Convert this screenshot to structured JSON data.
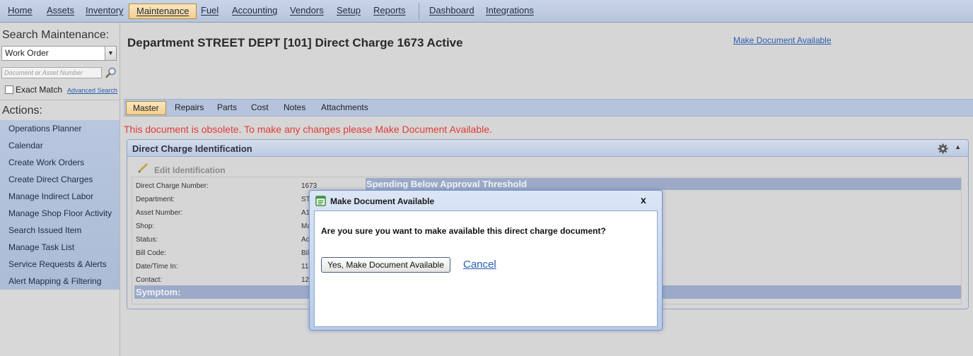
{
  "topmenu": {
    "items": [
      "Home",
      "Assets",
      "Inventory",
      "Maintenance",
      "Fuel",
      "Accounting",
      "Vendors",
      "Setup",
      "Reports",
      "Dashboard",
      "Integrations"
    ]
  },
  "left": {
    "search_title": "Search Maintenance:",
    "search_type": "Work Order",
    "doc_placeholder": "Document or Asset Number",
    "exact_match": "Exact Match",
    "advanced_search": "Advanced Search",
    "actions_title": "Actions:",
    "actions": [
      "Operations Planner",
      "Calendar",
      "Create Work Orders",
      "Create Direct Charges",
      "Manage Indirect Labor",
      "Manage Shop Floor Activity",
      "Search Issued Item",
      "Manage Task List",
      "Service Requests & Alerts",
      "Alert Mapping & Filtering"
    ]
  },
  "main": {
    "title": "Department STREET DEPT [101]  Direct Charge 1673  Active",
    "make_available_link": "Make Document Available",
    "tabs": [
      "Master",
      "Repairs",
      "Parts",
      "Cost",
      "Notes",
      "Attachments"
    ],
    "obsolete_msg": "This document is obsolete. To make any changes please Make Document Available.",
    "section_title": "Direct Charge Identification",
    "edit_label": "Edit Identification",
    "fields": [
      {
        "label": "Direct Charge Number:",
        "value": "1673"
      },
      {
        "label": "Department:",
        "value": "ST"
      },
      {
        "label": "Asset Number:",
        "value": "A1"
      },
      {
        "label": "Shop:",
        "value": "Ma"
      },
      {
        "label": "Status:",
        "value": "Ac"
      },
      {
        "label": "Bill Code:",
        "value": "Bil"
      },
      {
        "label": "Date/Time In:",
        "value": "11"
      },
      {
        "label": "Contact:",
        "value": "12"
      }
    ],
    "threshold": "Spending Below Approval Threshold",
    "symptom": "Symptom:"
  },
  "modal": {
    "title": "Make Document Available",
    "close": "x",
    "question": "Are you sure you want to make available this direct charge document?",
    "yes_label": "Yes, Make Document Available",
    "cancel_label": "Cancel"
  },
  "colors": {
    "menu_bg": "#b6c4dc",
    "active_tab": "#f2cf8e",
    "error_text": "#e03a3a",
    "link": "#2a5db0",
    "band": "#9caac8"
  }
}
